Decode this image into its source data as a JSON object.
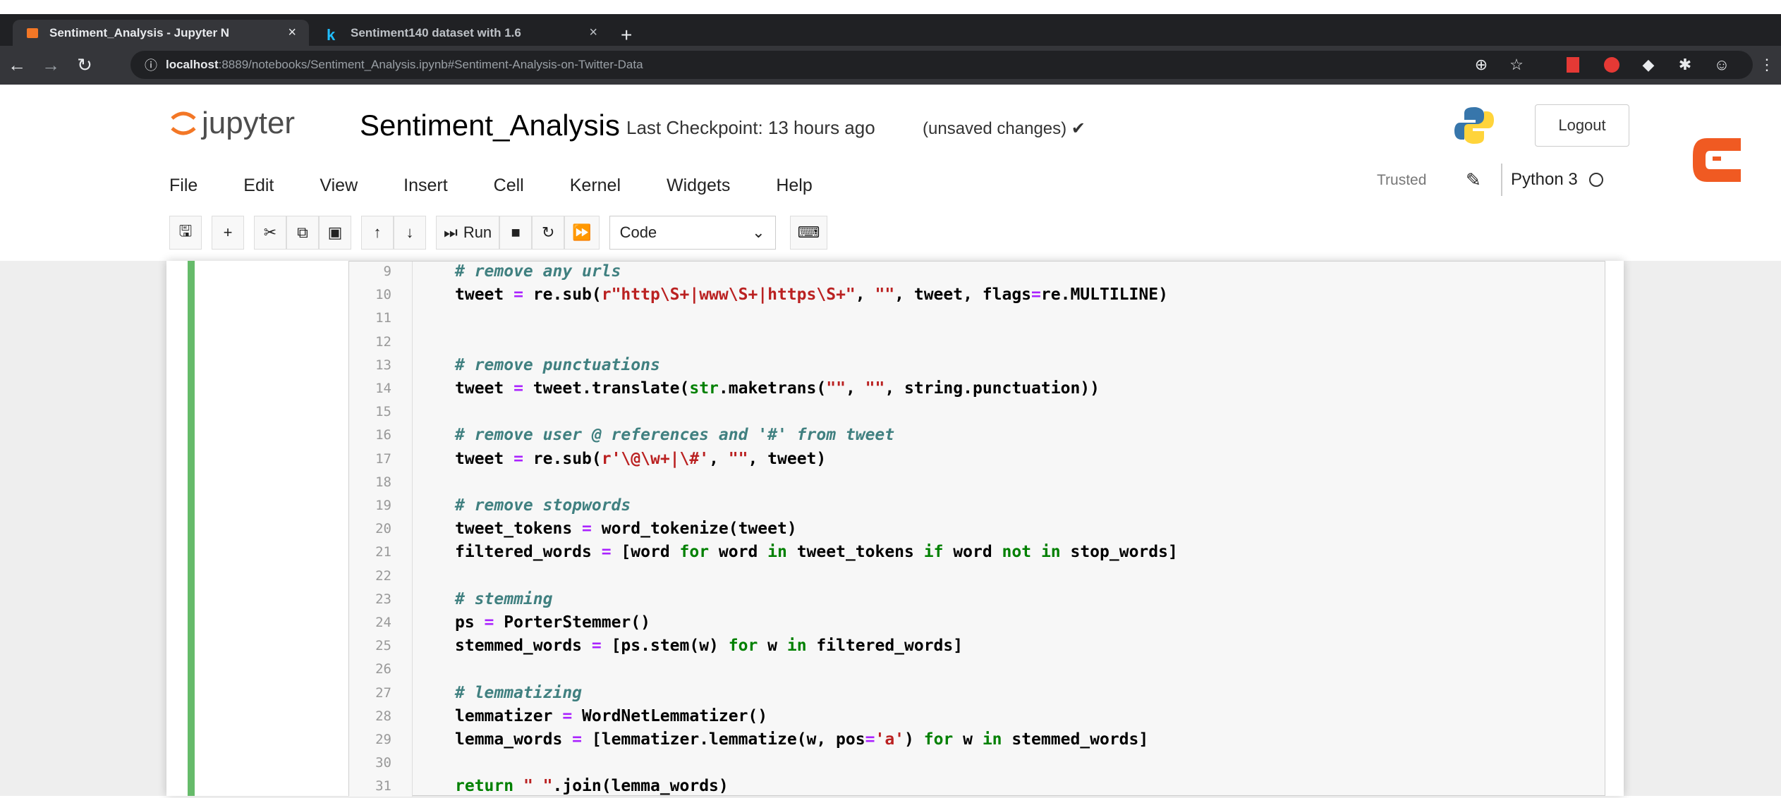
{
  "browser": {
    "tabs": [
      {
        "title": "Sentiment_Analysis - Jupyter N",
        "close": "×",
        "active": true
      },
      {
        "title": "Sentiment140 dataset with 1.6",
        "close": "×",
        "active": false
      }
    ],
    "new_tab": "+",
    "url_host": "localhost",
    "url_path": ":8889/notebooks/Sentiment_Analysis.ipynb#Sentiment-Analysis-on-Twitter-Data"
  },
  "jupyter": {
    "logo_text": "jupyter",
    "notebook_name": "Sentiment_Analysis",
    "checkpoint": "Last Checkpoint: 13 hours ago",
    "unsaved": "(unsaved changes) ✔",
    "logout": "Logout",
    "menu": [
      "File",
      "Edit",
      "View",
      "Insert",
      "Cell",
      "Kernel",
      "Widgets",
      "Help"
    ],
    "trusted": "Trusted",
    "kernel": "Python 3",
    "run_label": "Run",
    "cell_type": "Code"
  },
  "code": {
    "lines": [
      {
        "n": "9",
        "text": "# remove any urls",
        "kind": "comment"
      },
      {
        "n": "10",
        "text": "tweet = re.sub(r\"http\\S+|www\\S+|https\\S+\", \"\", tweet, flags=re.MULTILINE)",
        "kind": "code"
      },
      {
        "n": "11",
        "text": "",
        "kind": "code"
      },
      {
        "n": "12",
        "text": "",
        "kind": "code"
      },
      {
        "n": "13",
        "text": "# remove punctuations",
        "kind": "comment"
      },
      {
        "n": "14",
        "text": "tweet = tweet.translate(str.maketrans(\"\", \"\", string.punctuation))",
        "kind": "code"
      },
      {
        "n": "15",
        "text": "",
        "kind": "code"
      },
      {
        "n": "16",
        "text": "# remove user @ references and '#' from tweet",
        "kind": "comment"
      },
      {
        "n": "17",
        "text": "tweet = re.sub(r'\\@\\w+|\\#', \"\", tweet)",
        "kind": "code"
      },
      {
        "n": "18",
        "text": "",
        "kind": "code"
      },
      {
        "n": "19",
        "text": "# remove stopwords",
        "kind": "comment"
      },
      {
        "n": "20",
        "text": "tweet_tokens = word_tokenize(tweet)",
        "kind": "code"
      },
      {
        "n": "21",
        "text": "filtered_words = [word for word in tweet_tokens if word not in stop_words]",
        "kind": "code"
      },
      {
        "n": "22",
        "text": "",
        "kind": "code"
      },
      {
        "n": "23",
        "text": "# stemming",
        "kind": "comment"
      },
      {
        "n": "24",
        "text": "ps = PorterStemmer()",
        "kind": "code"
      },
      {
        "n": "25",
        "text": "stemmed_words = [ps.stem(w) for w in filtered_words]",
        "kind": "code"
      },
      {
        "n": "26",
        "text": "",
        "kind": "code"
      },
      {
        "n": "27",
        "text": "# lemmatizing",
        "kind": "comment"
      },
      {
        "n": "28",
        "text": "lemmatizer = WordNetLemmatizer()",
        "kind": "code"
      },
      {
        "n": "29",
        "text": "lemma_words = [lemmatizer.lemmatize(w, pos='a') for w in stemmed_words]",
        "kind": "code"
      },
      {
        "n": "30",
        "text": "",
        "kind": "code"
      },
      {
        "n": "31",
        "text": "return \" \".join(lemma_words)",
        "kind": "code"
      }
    ]
  },
  "colors": {
    "cell_border": "#66bb6a",
    "comment": "#408080",
    "keyword": "#008000",
    "string": "#ba2121"
  }
}
